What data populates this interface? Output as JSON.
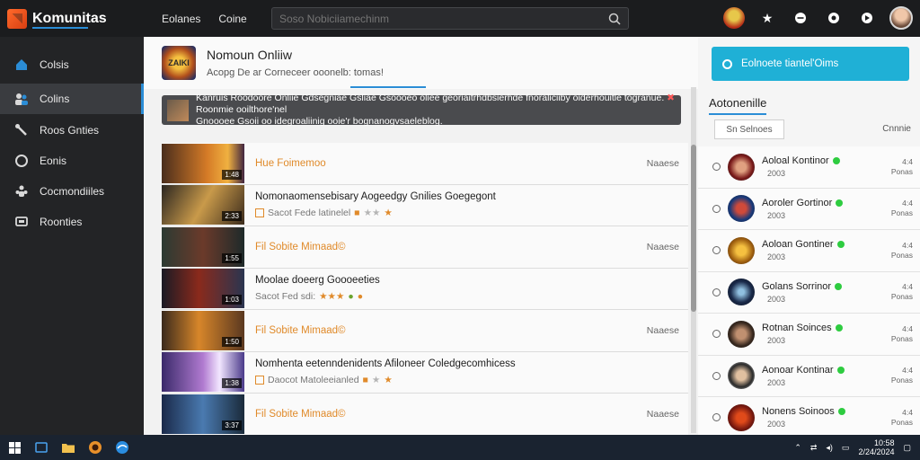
{
  "app": {
    "name": "Komunitas"
  },
  "top_nav": [
    "Eolanes",
    "Coine"
  ],
  "search": {
    "placeholder": "Soso Nobiciiamechinm"
  },
  "top_icons": [
    "game-avatar-icon",
    "star-icon",
    "minus-icon",
    "record-icon",
    "settings-icon",
    "user-avatar-icon"
  ],
  "sidebar": {
    "items": [
      {
        "label": "Colsis",
        "icon": "home-icon"
      },
      {
        "label": "Colins",
        "icon": "users-icon"
      },
      {
        "label": "Roos Gnties",
        "icon": "tools-icon"
      },
      {
        "label": "Eonis",
        "icon": "circle-icon"
      },
      {
        "label": "Cocmondiiles",
        "icon": "group-icon"
      },
      {
        "label": "Roonties",
        "icon": "chat-icon"
      }
    ],
    "active_index": 1
  },
  "main": {
    "header": {
      "title": "Nomoun Onliiw",
      "subtitle": "Acopg De ar Corneceer ooonelb: tomas!",
      "logo_text": "ZAIKI"
    },
    "notice": {
      "line1": "Kanruis Roodoore Onliie Gdsegniae Gsliae Gsoooeo oliee georiaitrhdbsierhde fnoraliciiby oiderhouitle togranue.",
      "line2": "Gnoooee Gsoii oo idegroaliinig ooie'r bognanogvsaeleblog.",
      "badge": "Roonmie ooilthore'nel"
    },
    "rows": [
      {
        "title": "Hue Foimemoo",
        "title_style": "orange",
        "duration": "1:48",
        "right_label": "Naaese",
        "has_stars": false,
        "thumb": "a"
      },
      {
        "title": "Nomonaomensebisary Aogeedgy Gnilies Goegegont",
        "title_style": "dark",
        "duration": "2:33",
        "right_label": "",
        "has_stars": true,
        "stars_text": "Sacot Fede latinelel",
        "stars": "orange-grey",
        "thumb": "b"
      },
      {
        "title": "Fil Sobite Mimaad©",
        "title_style": "orange",
        "duration": "1:55",
        "right_label": "Naaese",
        "has_stars": false,
        "thumb": "c"
      },
      {
        "title": "Moolae doeerg Goooeeties",
        "title_style": "dark",
        "duration": "1:03",
        "right_label": "",
        "has_stars": true,
        "stars_text": "Sacot Fed sdi:",
        "stars": "orange",
        "thumb": "d"
      },
      {
        "title": "Fil Sobite Mimaad©",
        "title_style": "orange",
        "duration": "1:50",
        "right_label": "Naaese",
        "has_stars": false,
        "thumb": "e"
      },
      {
        "title": "Nomhenta eetenndenidents Afiloneer Coledgecomhicess",
        "title_style": "dark",
        "duration": "1:38",
        "right_label": "",
        "has_stars": true,
        "stars_text": "Daocot Matoleeianled",
        "stars": "orange-grey",
        "thumb": "f"
      },
      {
        "title": "Fil Sobite Mimaad©",
        "title_style": "orange",
        "duration": "3:37",
        "right_label": "Naaese",
        "has_stars": false,
        "thumb": "g"
      }
    ]
  },
  "right": {
    "cta_label": "Eolnoete tiantel'Oims",
    "title": "Aotonenille",
    "filter_label": "Sn Selnoes",
    "col_label": "Cnnnie",
    "players": [
      {
        "name": "Aoloal Kontinor",
        "num": "2003",
        "rank1": "4:4",
        "rank2": "Ponas",
        "avatar": "p1"
      },
      {
        "name": "Aoroler Gortinor",
        "num": "2003",
        "rank1": "4:4",
        "rank2": "Ponas",
        "avatar": "p2"
      },
      {
        "name": "Aoloan Gontiner",
        "num": "2003",
        "rank1": "4:4",
        "rank2": "Ponas",
        "avatar": "p3"
      },
      {
        "name": "Golans Sorrinor",
        "num": "2003",
        "rank1": "4:4",
        "rank2": "Ponas",
        "avatar": "p4"
      },
      {
        "name": "Rotnan Soinces",
        "num": "2003",
        "rank1": "4:4",
        "rank2": "Ponas",
        "avatar": "p5"
      },
      {
        "name": "Aonoar Kontinar",
        "num": "2003",
        "rank1": "4:4",
        "rank2": "Ponas",
        "avatar": "p6"
      },
      {
        "name": "Nonens Soinoos",
        "num": "2003",
        "rank1": "4:4",
        "rank2": "Ponas",
        "avatar": "p7"
      }
    ]
  },
  "taskbar": {
    "apps": [
      "windows-icon",
      "taskview-icon",
      "folder-icon",
      "game-icon",
      "browser-icon"
    ],
    "clock_time": "10:58",
    "clock_date": "2/24/2024"
  },
  "colors": {
    "accent": "#2b8dd6",
    "cta": "#1fb0d6",
    "orange": "#e08a2a",
    "online": "#2ecc40"
  }
}
